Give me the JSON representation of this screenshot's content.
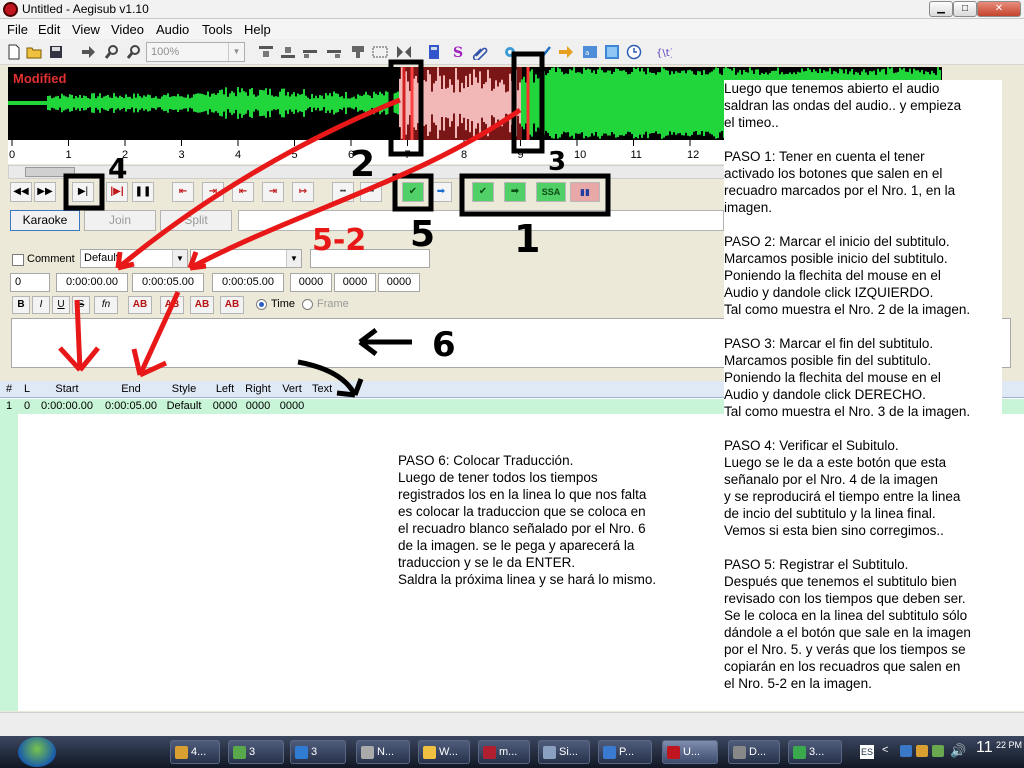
{
  "window": {
    "title": "Untitled - Aegisub v1.10"
  },
  "menu": [
    "File",
    "Edit",
    "View",
    "Video",
    "Audio",
    "Tools",
    "Help"
  ],
  "toolbar": {
    "zoom": "100%"
  },
  "audio": {
    "modified_label": "Modified",
    "ticks": [
      "0",
      "1",
      "2",
      "3",
      "4",
      "5",
      "6",
      "7",
      "8",
      "9",
      "10",
      "11",
      "12"
    ]
  },
  "tabs": {
    "karaoke": "Karaoke",
    "join": "Join",
    "split": "Split"
  },
  "edit": {
    "comment_label": "Comment",
    "style": "Default",
    "layer": "0",
    "start": "0:00:00.00",
    "end": "0:00:05.00",
    "duration": "0:00:05.00",
    "margin_l": "0000",
    "margin_r": "0000",
    "margin_v": "0000",
    "fmt_bold": "B",
    "fmt_italic": "I",
    "fmt_underline": "U",
    "fmt_strike": "S",
    "fmt_font": "fn",
    "fmt_primary": "AB",
    "fmt_secondary": "AB",
    "fmt_outline": "AB",
    "fmt_shadow": "AB",
    "radio_time": "Time",
    "radio_frame": "Frame"
  },
  "grid": {
    "headers": {
      "num": "#",
      "layer": "L",
      "start": "Start",
      "end": "End",
      "style": "Style",
      "left": "Left",
      "right": "Right",
      "vert": "Vert",
      "text": "Text"
    },
    "row": {
      "num": "1",
      "layer": "0",
      "start": "0:00:00.00",
      "end": "0:00:05.00",
      "style": "Default",
      "left": "0000",
      "right": "0000",
      "vert": "0000"
    }
  },
  "annotations": {
    "n1": "1",
    "n2": "2",
    "n3": "3",
    "n4": "4",
    "n5": "5",
    "n52": "5-2",
    "n6": "6",
    "right_lines": [
      "Luego que tenemos abierto el audio",
      "saldran las ondas del audio.. y empieza",
      "el timeo..",
      "",
      "PASO 1: Tener en cuenta el tener",
      "activado los botones que salen en el",
      "recuadro marcados por el Nro. 1, en la",
      "imagen.",
      "",
      "PASO 2: Marcar el inicio del subtitulo.",
      "Marcamos posible inicio del subtitulo.",
      "Poniendo la flechita del mouse en el",
      "Audio y dandole click IZQUIERDO.",
      "Tal como muestra el Nro. 2 de la imagen.",
      "",
      "PASO 3: Marcar el fin del subtitulo.",
      "Marcamos posible fin del subtitulo.",
      "Poniendo la flechita del mouse en el",
      "Audio y dandole click DERECHO.",
      "Tal como muestra el Nro. 3 de la imagen.",
      "",
      "PASO 4: Verificar el Subitulo.",
      "Luego se le da a este botón que esta",
      "señanalo por el Nro. 4 de la imagen",
      "y se reproducirá el tiempo entre la linea",
      "de incio del subtitulo y la linea final.",
      "Vemos si esta bien sino corregimos..",
      "",
      "PASO 5: Registrar el Subtitulo.",
      "Después que tenemos el subtitulo bien",
      "revisado con los tiempos que deben ser.",
      "Se le coloca en la linea del subtitulo sólo",
      "dándole a el botón que sale en la imagen",
      "por el Nro. 5. y verás que los tiempos se",
      "copiarán en los recuadros que salen en",
      "el Nro. 5-2 en la imagen."
    ],
    "paso6_lines": [
      "PASO 6: Colocar Traducción.",
      "Luego de tener todos los tiempos",
      "registrados los en la linea lo que nos falta",
      "es colocar la traduccion que se coloca en",
      "el recuadro blanco señalado por el Nro. 6",
      "de la imagen. se le pega y aparecerá la",
      "traduccion y se le da ENTER.",
      "Saldra la próxima linea y se hará lo mismo."
    ]
  },
  "taskbar": {
    "items": [
      "4...",
      "3",
      "3",
      "N...",
      "W...",
      "m...",
      "Si...",
      "P...",
      "U...",
      "D...",
      "3..."
    ],
    "lang": "ES",
    "clock": "11",
    "clock_small": "22 PM"
  },
  "colors": {
    "waveform": "#21d63a",
    "selection": "#7a1616",
    "selection_wave": "#f2b8b8",
    "annotation_red": "#e81818"
  }
}
